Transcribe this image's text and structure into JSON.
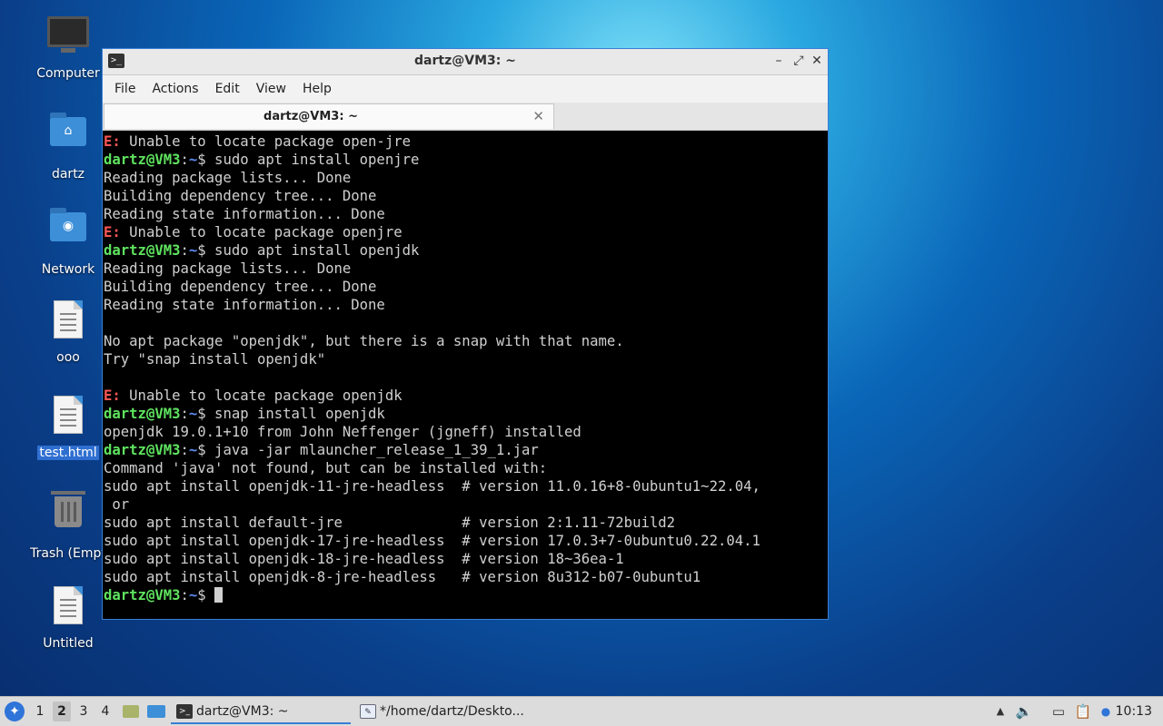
{
  "desktop": {
    "icons": [
      {
        "label": "Computer"
      },
      {
        "label": "dartz"
      },
      {
        "label": "Network"
      },
      {
        "label": "ooo"
      },
      {
        "label": "test.html"
      },
      {
        "label": "Trash (Empt"
      },
      {
        "label": "Untitled"
      }
    ]
  },
  "window": {
    "title": "dartz@VM3: ~",
    "menu": [
      "File",
      "Actions",
      "Edit",
      "View",
      "Help"
    ],
    "tab_title": "dartz@VM3: ~",
    "prompt_user": "dartz@VM3",
    "prompt_path": "~",
    "prompt_symbol": "$",
    "lines": [
      {
        "err": "E:",
        "text": " Unable to locate package open-jre"
      },
      {
        "cmd": " sudo apt install openjre"
      },
      {
        "text": "Reading package lists... Done"
      },
      {
        "text": "Building dependency tree... Done"
      },
      {
        "text": "Reading state information... Done"
      },
      {
        "err": "E:",
        "text": " Unable to locate package openjre"
      },
      {
        "cmd": " sudo apt install openjdk"
      },
      {
        "text": "Reading package lists... Done"
      },
      {
        "text": "Building dependency tree... Done"
      },
      {
        "text": "Reading state information... Done"
      },
      {
        "text": ""
      },
      {
        "text": "No apt package \"openjdk\", but there is a snap with that name."
      },
      {
        "text": "Try \"snap install openjdk\""
      },
      {
        "text": ""
      },
      {
        "err": "E:",
        "text": " Unable to locate package openjdk"
      },
      {
        "cmd": " snap install openjdk"
      },
      {
        "text": "openjdk 19.0.1+10 from John Neffenger (jgneff) installed"
      },
      {
        "cmd": " java -jar mlauncher_release_1_39_1.jar"
      },
      {
        "text": "Command 'java' not found, but can be installed with:"
      },
      {
        "text": "sudo apt install openjdk-11-jre-headless  # version 11.0.16+8-0ubuntu1~22.04,"
      },
      {
        "text": " or"
      },
      {
        "text": "sudo apt install default-jre              # version 2:1.11-72build2"
      },
      {
        "text": "sudo apt install openjdk-17-jre-headless  # version 17.0.3+7-0ubuntu0.22.04.1"
      },
      {
        "text": "sudo apt install openjdk-18-jre-headless  # version 18~36ea-1"
      },
      {
        "text": "sudo apt install openjdk-8-jre-headless   # version 8u312-b07-0ubuntu1"
      },
      {
        "cmd": " ",
        "cursor": true
      }
    ]
  },
  "taskbar": {
    "workspaces": [
      "1",
      "2",
      "3",
      "4"
    ],
    "active_workspace": "2",
    "tasks": [
      {
        "label": "dartz@VM3: ~",
        "icon": "terminal-icon",
        "active": true
      },
      {
        "label": "*/home/dartz/Deskto...",
        "icon": "text-editor-icon",
        "active": false
      }
    ],
    "clock": "10:13"
  },
  "colors": {
    "accent": "#3a7fd6",
    "prompt_user": "#5fe35f",
    "prompt_path": "#5d8cf0",
    "error": "#ff5555"
  }
}
